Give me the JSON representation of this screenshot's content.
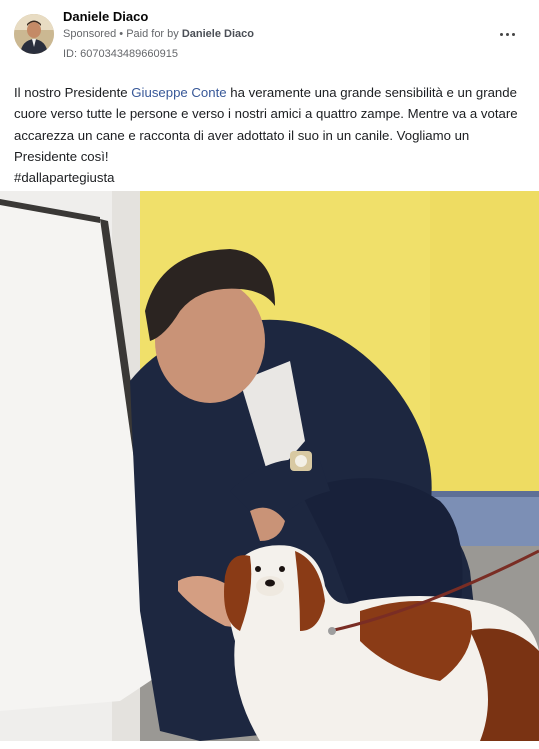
{
  "post": {
    "page_name": "Daniele Diaco",
    "sponsored_label": "Sponsored",
    "separator": " • ",
    "paid_for_prefix": "Paid for by ",
    "paid_for_name": "Daniele Diaco",
    "ad_id": "ID: 6070343489660915",
    "more_icon": "ellipsis-icon",
    "text": {
      "part1": "Il nostro Presidente ",
      "link": "Giuseppe Conte",
      "part2": " ha veramente una grande sensibilità e un grande cuore verso tutte le persone e verso i nostri amici a quattro zampe. Mentre va a votare accarezza un cane e racconta di aver adottato il suo in un canile. Vogliamo un Presidente così!",
      "hashtag": "#dallapartegiusta"
    },
    "colors": {
      "link": "#385898",
      "wall_yellow": "#f2e36e",
      "suit_navy": "#1d2740",
      "dog_brown": "#8a3b16"
    }
  }
}
